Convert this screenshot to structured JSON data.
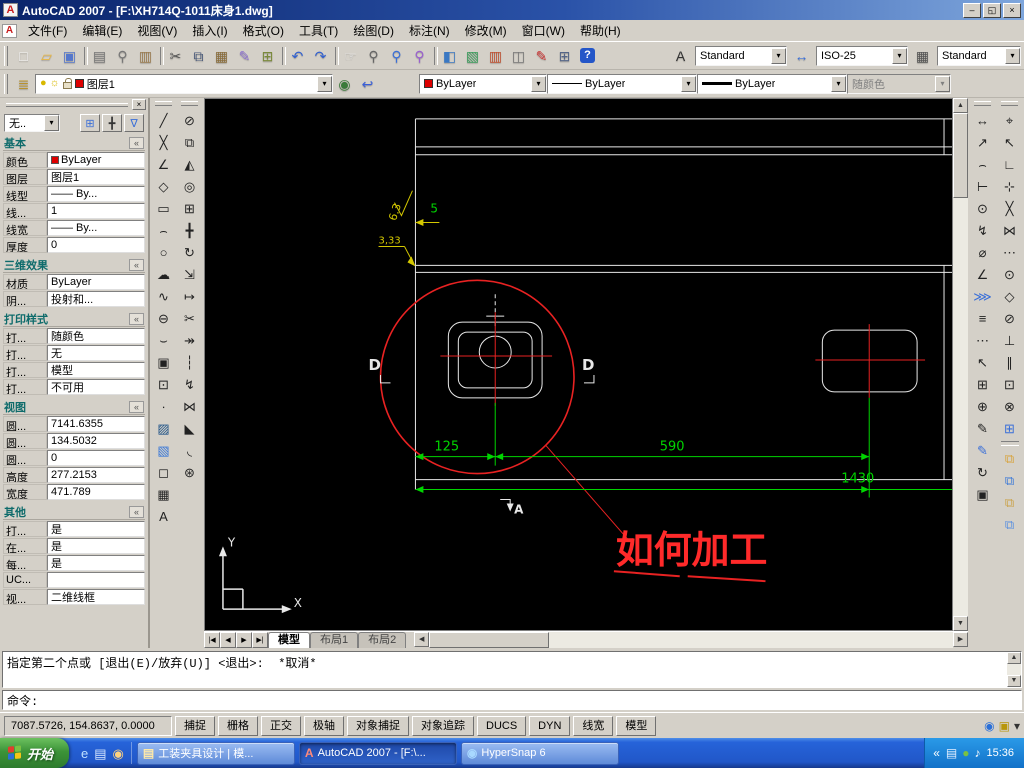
{
  "window": {
    "title": "AutoCAD 2007 - [F:\\XH714Q-1011床身1.dwg]",
    "icon_glyph": "A",
    "controls": {
      "minimize": "–",
      "restore": "◱",
      "close": "×"
    }
  },
  "ui": {
    "scroll_up": "▲",
    "scroll_down": "▼",
    "scroll_left": "◀",
    "scroll_right": "▶",
    "dropdown": "▾",
    "collapse": "«",
    "palette_close": "×",
    "tray_chevron": "«"
  },
  "menu": {
    "items": [
      "文件(F)",
      "编辑(E)",
      "视图(V)",
      "插入(I)",
      "格式(O)",
      "工具(T)",
      "绘图(D)",
      "标注(N)",
      "修改(M)",
      "窗口(W)",
      "帮助(H)"
    ]
  },
  "toolbar1": {
    "buttons": [
      {
        "name": "new-button",
        "glyph": "□",
        "color": "#f8f8f8"
      },
      {
        "name": "open-button",
        "glyph": "▱",
        "color": "#e8b53e"
      },
      {
        "name": "save-button",
        "glyph": "▣",
        "color": "#5577cc"
      },
      {
        "sep": true,
        "name": "separator"
      },
      {
        "name": "plot-button",
        "glyph": "▤",
        "color": "#777777"
      },
      {
        "name": "plot-preview-button",
        "glyph": "⚲",
        "color": "#777777"
      },
      {
        "name": "publish-button",
        "glyph": "▥",
        "color": "#9a7b4f"
      },
      {
        "sep": true,
        "name": "separator"
      },
      {
        "name": "cut-button",
        "glyph": "✂",
        "color": "#555555"
      },
      {
        "name": "copy-button",
        "glyph": "⧉",
        "color": "#445577"
      },
      {
        "name": "paste-button",
        "glyph": "▦",
        "color": "#8a6d3b"
      },
      {
        "name": "match-properties-button",
        "glyph": "✎",
        "color": "#8a6fd0"
      },
      {
        "name": "block-editor-button",
        "glyph": "⊞",
        "color": "#7a8a3a"
      },
      {
        "sep": true,
        "name": "separator"
      },
      {
        "name": "undo-button",
        "glyph": "↶",
        "color": "#2f5fd0"
      },
      {
        "name": "redo-button",
        "glyph": "↷",
        "color": "#2f5fd0"
      },
      {
        "sep": true,
        "name": "separator"
      },
      {
        "name": "pan-button",
        "glyph": "☞",
        "color": "#e8e8e8"
      },
      {
        "name": "zoom-realtime-button",
        "glyph": "⚲",
        "color": "#666666"
      },
      {
        "name": "zoom-window-button",
        "glyph": "⚲",
        "color": "#3a6fd8"
      },
      {
        "name": "zoom-previous-button",
        "glyph": "⚲",
        "color": "#9a5fd0"
      },
      {
        "sep": true,
        "name": "separator"
      },
      {
        "name": "properties-button",
        "glyph": "◧",
        "color": "#3a78c3"
      },
      {
        "name": "designcenter-button",
        "glyph": "▧",
        "color": "#3a9d5c"
      },
      {
        "name": "tool-palettes-button",
        "glyph": "▥",
        "color": "#c05030"
      },
      {
        "name": "sheet-set-manager-button",
        "glyph": "◫",
        "color": "#777777"
      },
      {
        "name": "markup-set-manager-button",
        "glyph": "✎",
        "color": "#cc3333"
      },
      {
        "name": "quickcalc-button",
        "glyph": "⊞",
        "color": "#556688"
      },
      {
        "name": "help-button",
        "glyph": "?",
        "color": "#ffffff",
        "help": true
      }
    ],
    "style_icons": [
      {
        "name": "text-style-icon",
        "glyph": "A",
        "color": "#333333"
      },
      {
        "name": "dim-style-icon",
        "glyph": "↔",
        "color": "#3a6fd8"
      },
      {
        "name": "table-style-icon",
        "glyph": "▦",
        "color": "#555555"
      }
    ],
    "styles": {
      "text": "Standard",
      "dim": "ISO-25",
      "table": "Standard"
    }
  },
  "toolbar2": {
    "left_buttons": [
      {
        "name": "layer-properties-manager-button",
        "glyph": "≣",
        "color": "#b8922e"
      }
    ],
    "after_buttons": [
      {
        "name": "make-object-layer-current-button",
        "glyph": "◉",
        "color": "#3a7a3a"
      },
      {
        "name": "layer-previous-button",
        "glyph": "↩",
        "color": "#3a5fd8"
      }
    ],
    "layer_icons": {
      "on": "●",
      "freeze": "☼"
    },
    "layer": "图层1",
    "color": "ByLayer",
    "linetype": "ByLayer",
    "lineweight": "ByLayer",
    "plotstyle": "随颜色"
  },
  "draw_toolbar": [
    {
      "name": "line-button",
      "glyph": "╱",
      "color": "#222222"
    },
    {
      "name": "construction-line-button",
      "glyph": "╳",
      "color": "#222222"
    },
    {
      "name": "polyline-button",
      "glyph": "∠",
      "color": "#222222"
    },
    {
      "name": "polygon-button",
      "glyph": "◇",
      "color": "#222222"
    },
    {
      "name": "rectangle-button",
      "glyph": "▭",
      "color": "#222222"
    },
    {
      "name": "arc-button",
      "glyph": "⌢",
      "color": "#222222"
    },
    {
      "name": "circle-button",
      "glyph": "○",
      "color": "#222222"
    },
    {
      "name": "revision-cloud-button",
      "glyph": "☁",
      "color": "#222222"
    },
    {
      "name": "spline-button",
      "glyph": "∿",
      "color": "#222222"
    },
    {
      "name": "ellipse-button",
      "glyph": "⊖",
      "color": "#222222"
    },
    {
      "name": "ellipse-arc-button",
      "glyph": "⌣",
      "color": "#222222"
    },
    {
      "name": "insert-block-button",
      "glyph": "▣",
      "color": "#222222"
    },
    {
      "name": "make-block-button",
      "glyph": "⊡",
      "color": "#222222"
    },
    {
      "name": "point-button",
      "glyph": "∙",
      "color": "#222222"
    },
    {
      "name": "hatch-button",
      "glyph": "▨",
      "color": "#225588"
    },
    {
      "name": "gradient-button",
      "glyph": "▧",
      "color": "#3a78d8"
    },
    {
      "name": "region-button",
      "glyph": "◻",
      "color": "#222222"
    },
    {
      "name": "table-button",
      "glyph": "▦",
      "color": "#222222"
    },
    {
      "name": "mtext-button",
      "glyph": "A",
      "color": "#222222"
    }
  ],
  "modify_toolbar": [
    {
      "name": "erase-button",
      "glyph": "⊘",
      "color": "#222222"
    },
    {
      "name": "copy-object-button",
      "glyph": "⧉",
      "color": "#222222"
    },
    {
      "name": "mirror-button",
      "glyph": "◭",
      "color": "#222222"
    },
    {
      "name": "offset-button",
      "glyph": "◎",
      "color": "#222222"
    },
    {
      "name": "array-button",
      "glyph": "⊞",
      "color": "#222222"
    },
    {
      "name": "move-button",
      "glyph": "╋",
      "color": "#222222"
    },
    {
      "name": "rotate-button",
      "glyph": "↻",
      "color": "#222222"
    },
    {
      "name": "scale-button",
      "glyph": "⇲",
      "color": "#222222"
    },
    {
      "name": "stretch-button",
      "glyph": "↦",
      "color": "#222222"
    },
    {
      "name": "trim-button",
      "glyph": "✂",
      "color": "#222222"
    },
    {
      "name": "extend-button",
      "glyph": "↠",
      "color": "#222222"
    },
    {
      "name": "break-at-point-button",
      "glyph": "┆",
      "color": "#222222"
    },
    {
      "name": "break-button",
      "glyph": "↯",
      "color": "#222222"
    },
    {
      "name": "join-button",
      "glyph": "⋈",
      "color": "#222222"
    },
    {
      "name": "chamfer-button",
      "glyph": "◣",
      "color": "#222222"
    },
    {
      "name": "fillet-button",
      "glyph": "◟",
      "color": "#222222"
    },
    {
      "name": "explode-button",
      "glyph": "⊛",
      "color": "#222222"
    }
  ],
  "dim_toolbar": [
    {
      "name": "linear-dimension-button",
      "glyph": "↔",
      "color": "#222222"
    },
    {
      "name": "aligned-dimension-button",
      "glyph": "↗",
      "color": "#222222"
    },
    {
      "name": "arc-length-dimension-button",
      "glyph": "⌢",
      "color": "#222222"
    },
    {
      "name": "ordinate-dimension-button",
      "glyph": "⊢",
      "color": "#222222"
    },
    {
      "name": "radius-dimension-button",
      "glyph": "⊙",
      "color": "#222222"
    },
    {
      "name": "jogged-dimension-button",
      "glyph": "↯",
      "color": "#222222"
    },
    {
      "name": "diameter-dimension-button",
      "glyph": "⌀",
      "color": "#222222"
    },
    {
      "name": "angular-dimension-button",
      "glyph": "∠",
      "color": "#222222"
    },
    {
      "name": "quick-dimension-button",
      "glyph": "⋙",
      "color": "#3a6fd8"
    },
    {
      "name": "baseline-dimension-button",
      "glyph": "≡",
      "color": "#222222"
    },
    {
      "name": "continue-dimension-button",
      "glyph": "⋯",
      "color": "#222222"
    },
    {
      "name": "quick-leader-button",
      "glyph": "↖",
      "color": "#222222"
    },
    {
      "name": "tolerance-button",
      "glyph": "⊞",
      "color": "#222222"
    },
    {
      "name": "center-mark-button",
      "glyph": "⊕",
      "color": "#222222"
    },
    {
      "name": "dimension-edit-button",
      "glyph": "✎",
      "color": "#222222"
    },
    {
      "name": "dimension-text-edit-button",
      "glyph": "✎",
      "color": "#3a6fd8"
    },
    {
      "name": "dimension-update-button",
      "glyph": "↻",
      "color": "#222222"
    },
    {
      "name": "dimension-style-button",
      "glyph": "▣",
      "color": "#222222"
    }
  ],
  "osnap_toolbar": [
    {
      "name": "temporary-track-point-button",
      "glyph": "⌖",
      "color": "#222222"
    },
    {
      "name": "snap-from-button",
      "glyph": "↖",
      "color": "#222222"
    },
    {
      "name": "snap-endpoint-button",
      "glyph": "∟",
      "color": "#222222"
    },
    {
      "name": "snap-midpoint-button",
      "glyph": "⊹",
      "color": "#222222"
    },
    {
      "name": "snap-intersection-button",
      "glyph": "╳",
      "color": "#222222"
    },
    {
      "name": "snap-apparent-intersection-button",
      "glyph": "⋈",
      "color": "#222222"
    },
    {
      "name": "snap-extension-button",
      "glyph": "⋯",
      "color": "#222222"
    },
    {
      "name": "snap-center-button",
      "glyph": "⊙",
      "color": "#222222"
    },
    {
      "name": "snap-quadrant-button",
      "glyph": "◇",
      "color": "#222222"
    },
    {
      "name": "snap-tangent-button",
      "glyph": "⊘",
      "color": "#222222"
    },
    {
      "name": "snap-perpendicular-button",
      "glyph": "⊥",
      "color": "#222222"
    },
    {
      "name": "snap-parallel-button",
      "glyph": "∥",
      "color": "#222222"
    },
    {
      "name": "snap-node-button",
      "glyph": "⊡",
      "color": "#222222"
    },
    {
      "name": "snap-nearest-button",
      "glyph": "⊗",
      "color": "#222222"
    },
    {
      "name": "osnap-settings-button",
      "glyph": "⊞",
      "color": "#3a6fd8"
    },
    {
      "sep": true,
      "name": "separator"
    },
    {
      "name": "draw-order-bring-to-front-button",
      "glyph": "⧉",
      "color": "#d8a23a"
    },
    {
      "name": "draw-order-send-to-back-button",
      "glyph": "⧉",
      "color": "#3a78d8"
    },
    {
      "name": "draw-order-bring-above-button",
      "glyph": "⧉",
      "color": "#caa24a"
    },
    {
      "name": "draw-order-send-under-button",
      "glyph": "⧉",
      "color": "#5a8fe0"
    }
  ],
  "palette": {
    "selector": "无..",
    "selector_buttons": [
      {
        "name": "toggle-pickadd-button",
        "glyph": "⊞",
        "color": "#3a6fd8"
      },
      {
        "name": "select-objects-button",
        "glyph": "╋",
        "color": "#333333"
      },
      {
        "name": "quick-select-button",
        "glyph": "∇",
        "color": "#3a6fd8"
      }
    ],
    "sections": [
      {
        "title": "基本",
        "rows": [
          {
            "label": "颜色",
            "value": "ByLayer",
            "swatch": "#dd0000"
          },
          {
            "label": "图层",
            "value": "图层1"
          },
          {
            "label": "线型",
            "value": "—— By..."
          },
          {
            "label": "线...",
            "value": "1"
          },
          {
            "label": "线宽",
            "value": "—— By..."
          },
          {
            "label": "厚度",
            "value": "0"
          }
        ]
      },
      {
        "title": "三维效果",
        "rows": [
          {
            "label": "材质",
            "value": "ByLayer"
          },
          {
            "label": "阴...",
            "value": "投射和..."
          }
        ]
      },
      {
        "title": "打印样式",
        "rows": [
          {
            "label": "打...",
            "value": "随颜色"
          },
          {
            "label": "打...",
            "value": "无"
          },
          {
            "label": "打...",
            "value": "模型"
          },
          {
            "label": "打...",
            "value": "不可用"
          }
        ]
      },
      {
        "title": "视图",
        "rows": [
          {
            "label": "圆...",
            "value": "7141.6355"
          },
          {
            "label": "圆...",
            "value": "134.5032"
          },
          {
            "label": "圆...",
            "value": "0"
          },
          {
            "label": "高度",
            "value": "277.2153"
          },
          {
            "label": "宽度",
            "value": "471.789"
          }
        ]
      },
      {
        "title": "其他",
        "rows": [
          {
            "label": "打...",
            "value": "是"
          },
          {
            "label": "在...",
            "value": "是"
          },
          {
            "label": "每...",
            "value": "是"
          },
          {
            "label": "UC...",
            "value": ""
          },
          {
            "label": "视...",
            "value": "二维线框"
          }
        ]
      }
    ]
  },
  "tabs": {
    "nav": [
      "|◀",
      "◀",
      "▶",
      "▶|"
    ],
    "items": [
      "模型",
      "布局1",
      "布局2"
    ],
    "active": 0
  },
  "command": {
    "history": "指定第二个点或 [退出(E)/放弃(U)] <退出>:  *取消*",
    "prompt": "命令:"
  },
  "statusbar": {
    "coords": "7087.5726, 154.8637, 0.0000",
    "buttons": [
      "捕捉",
      "栅格",
      "正交",
      "极轴",
      "对象捕捉",
      "对象追踪",
      "DUCS",
      "DYN",
      "线宽",
      "模型"
    ],
    "icons": [
      {
        "name": "communication-center-icon",
        "glyph": "◉",
        "color": "#2a6fd8"
      },
      {
        "name": "toolbar-lock-icon",
        "glyph": "▣",
        "color": "#b8960a"
      },
      {
        "name": "status-menu-arrow-icon",
        "glyph": "▾",
        "color": "#333333"
      }
    ]
  },
  "drawing": {
    "dim_125": "125",
    "dim_590": "590",
    "dim_1430": "1430",
    "dim_5": "5",
    "dim_333": "3,33",
    "roughness": "6.3",
    "note": "如何加工",
    "section_label": "D",
    "detail_label": "A",
    "axis_x": "X",
    "axis_y": "Y",
    "colors": {
      "geometry": "#e8e8e8",
      "dimension": "#00d400",
      "annotation": "#ff2a2a",
      "aux": "#d4c800"
    }
  },
  "taskbar": {
    "start": "开始",
    "quick_launch": [
      {
        "name": "ie-icon",
        "glyph": "e",
        "color": "#bfe0ff"
      },
      {
        "name": "show-desktop-icon",
        "glyph": "▤",
        "color": "#d8e8ff"
      },
      {
        "name": "media-player-icon",
        "glyph": "◉",
        "color": "#ffd27f"
      }
    ],
    "tasks": [
      {
        "icon": "▤",
        "color": "#ffe9a8",
        "label": "工装夹具设计 | 模..."
      },
      {
        "icon": "A",
        "color": "#ff8a7a",
        "label": "AutoCAD 2007 - [F:\\...",
        "active": true
      },
      {
        "icon": "◉",
        "color": "#a8d8ff",
        "label": "HyperSnap 6"
      }
    ],
    "tray_icons": [
      {
        "name": "printer-tray-icon",
        "glyph": "▤",
        "color": "#e4efff"
      },
      {
        "name": "shield-tray-icon",
        "glyph": "●",
        "color": "#7ac143"
      },
      {
        "name": "volume-tray-icon",
        "glyph": "♪",
        "color": "#ffffff"
      }
    ],
    "time": "15:36"
  }
}
